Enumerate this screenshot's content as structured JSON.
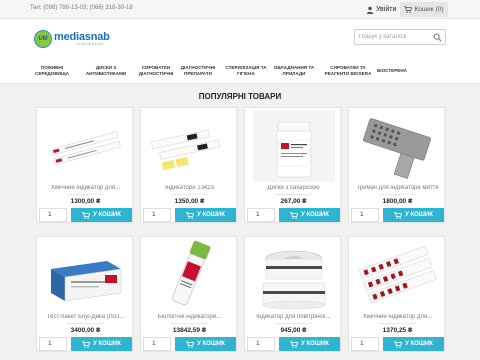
{
  "topbar": {
    "phones": "Тел: (098) 798-13-03; (066) 318-30-18",
    "login_label": "Увійти",
    "cart_label": "Кошик",
    "cart_count": "(0)"
  },
  "header": {
    "logo_mark": "UM",
    "logo_name": "mediasnab",
    "logo_tagline": "ukrmediasnab",
    "search_placeholder": "Пошук у каталозі"
  },
  "nav": [
    [
      "Поживні",
      "середовища"
    ],
    [
      "Диски з",
      "антибіотиками"
    ],
    [
      "Сироватки",
      "діагностичні"
    ],
    [
      "Діагностичні",
      "препарати"
    ],
    [
      "Стерилізація та",
      "гігієна"
    ],
    [
      "Обладнання та",
      "прилади"
    ],
    [
      "Сироватки та",
      "реагенти BIOSERA"
    ],
    [
      "Біостерена",
      ""
    ]
  ],
  "section_title": "Популярні товари",
  "products": [
    {
      "title": "Хімічний індикатор для...",
      "price": "1300,00 ₴",
      "qty": "1",
      "buy": "У кошик",
      "image_icon": "chemical-indicator-strips"
    },
    {
      "title": "Індикатори 13423",
      "price": "1350,00 ₴",
      "qty": "1",
      "buy": "У кошик",
      "image_icon": "indicator-strips-13423"
    },
    {
      "title": "Диски з сахарозою",
      "price": "267,00 ₴",
      "qty": "1",
      "buy": "У кошик",
      "image_icon": "sucrose-discs-vial"
    },
    {
      "title": "Тримач для індикатора миття",
      "price": "1800,00 ₴",
      "qty": "1",
      "buy": "У кошик",
      "image_icon": "washing-indicator-holder"
    },
    {
      "title": "Тест-пакет Боуі-Дика (ISO...",
      "price": "3400,00 ₴",
      "qty": "1",
      "buy": "У кошик",
      "image_icon": "bowie-dick-test-pack"
    },
    {
      "title": "Біологічні індикатори...",
      "price": "13842,59 ₴",
      "qty": "1",
      "buy": "У кошик",
      "image_icon": "biological-indicator-vial"
    },
    {
      "title": "Індикатор для повітряної...",
      "price": "945,00 ₴",
      "qty": "1",
      "buy": "У кошик",
      "image_icon": "indicator-tape-rolls"
    },
    {
      "title": "Хімічний індикатор для...",
      "price": "1370,25 ₴",
      "qty": "1",
      "buy": "У кошик",
      "image_icon": "chemical-indicator-cards"
    }
  ],
  "colors": {
    "accent": "#2fb5d2",
    "background": "#f1f1f1",
    "logo_green": "#8cc63f",
    "logo_blue": "#1d6fb8"
  }
}
